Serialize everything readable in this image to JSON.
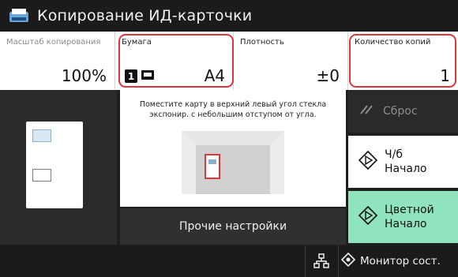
{
  "window": {
    "title": "Копирование ИД-карточки"
  },
  "settings": {
    "scale": {
      "label": "Масштаб копирования",
      "value": "100%"
    },
    "paper": {
      "label": "Бумага",
      "tray": "1",
      "size": "A4"
    },
    "density": {
      "label": "Плотность",
      "value": "±0"
    },
    "copies": {
      "label": "Количество копий",
      "value": "1"
    }
  },
  "instruction": "Поместите карту в верхний левый угол стекла экспонир. с небольшим отступом от угла.",
  "other_settings": "Прочие настройки",
  "actions": {
    "reset": "Сброс",
    "bw_start": [
      "Ч/б",
      "Начало"
    ],
    "color_start": [
      "Цветной",
      "Начало"
    ]
  },
  "statusbar": {
    "monitor": "Монитор сост."
  },
  "colors": {
    "highlight": "#e0353b",
    "color_start_bg": "#8fe3bd"
  },
  "icons": [
    "copy-app-icon",
    "paper-tray-icon",
    "reset-icon",
    "start-icon",
    "network-icon",
    "monitor-icon"
  ]
}
